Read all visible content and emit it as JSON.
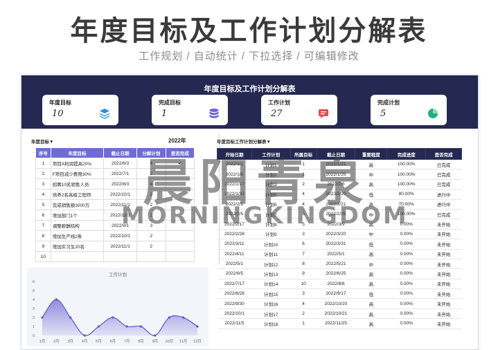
{
  "hero": {
    "title": "年度目标及工作计划分解表",
    "subtitle": "工作规划 / 自动统计 / 下拉选择 / 可编辑修改"
  },
  "sheet": {
    "banner_title": "年度目标及工作计划分解表",
    "kpis": [
      {
        "label": "年度目标",
        "value": "10",
        "icon": "layers-icon",
        "color": "#2f8fe0"
      },
      {
        "label": "完成目标",
        "value": "1",
        "icon": "database-icon",
        "color": "#6c63d8"
      },
      {
        "label": "工作计划",
        "value": "27",
        "icon": "chat-icon",
        "color": "#e04a4a"
      },
      {
        "label": "完成计划",
        "value": "5",
        "icon": "pie-icon",
        "color": "#22b07d"
      }
    ]
  },
  "left": {
    "selector_label": "年度目标▼",
    "year_label": "2022年",
    "headers": [
      "序号",
      "年度目标",
      "截止日期",
      "分解计划",
      "是否完成"
    ],
    "rows": [
      [
        "1",
        "项目A利润提高20%",
        "2022/6/3",
        "4",
        "✔"
      ],
      [
        "2",
        "F项目减少费用30%",
        "2022/7/1",
        "2",
        ""
      ],
      [
        "3",
        "招聘10名销售人员",
        "2022/8/3",
        "4",
        ""
      ],
      [
        "4",
        "培养2名高级工程师",
        "2022/10/1",
        "2",
        ""
      ],
      [
        "5",
        "完成销售额3000万",
        "2022/11/1",
        "2",
        ""
      ],
      [
        "6",
        "增加部门1个",
        "2022/12/1",
        "2",
        ""
      ],
      [
        "7",
        "调整薪酬结构",
        "2022/9/1",
        "3",
        ""
      ],
      [
        "8",
        "增加生产线2条",
        "2022/10/1",
        "2",
        ""
      ],
      [
        "9",
        "增加实习生20名",
        "2022/11/1",
        "2",
        ""
      ],
      [
        "10",
        "",
        "",
        "",
        ""
      ]
    ]
  },
  "watermark": {
    "line1": "晨阳青泉",
    "line2": "MORNINGKINGDOM"
  },
  "chart_data": {
    "type": "area",
    "title": "工作计划",
    "categories": [
      "1月",
      "2月",
      "3月",
      "4月",
      "5月",
      "6月",
      "7月",
      "8月",
      "9月",
      "10月",
      "11月",
      "12月"
    ],
    "values": [
      2,
      4,
      2,
      0,
      1,
      2,
      1,
      1,
      0,
      2,
      2,
      1
    ],
    "ylim": [
      0,
      6
    ],
    "yticks": [
      "0",
      "1",
      "2",
      "3",
      "4",
      "5",
      "6"
    ],
    "color": "#7e7ad8",
    "grid": false
  },
  "right": {
    "selector_label": "年度目标工作计划分解表▼",
    "headers": [
      "开始日期",
      "工作计划",
      "所属目标",
      "截止日期",
      "重要程度",
      "完成进度",
      "是否完成"
    ],
    "rows": [
      [
        "2022/1/1",
        "计划1",
        "1",
        "2022/1/21",
        "高",
        "100.00%",
        "已完成"
      ],
      [
        "2022/1/5",
        "计划2",
        "1",
        "2022/1/25",
        "中",
        "100.00%",
        "已完成"
      ],
      [
        "2022/1/17",
        "计划3",
        "2",
        "2022/2/6",
        "高",
        "100.00%",
        "已完成"
      ],
      [
        "2022/1/31",
        "计划5",
        "4",
        "2022/2/20",
        "低",
        "80.00%",
        "进行中"
      ],
      [
        "2022/2/1",
        "计划6",
        "4",
        "2022/2/21",
        "高",
        "70.00%",
        "进行中"
      ],
      [
        "2022/2/5",
        "计划7",
        "5",
        "2022/2/25",
        "中",
        "100.00%",
        "已完成"
      ],
      [
        "2022/2/17",
        "计划8",
        "5",
        "2022/3/9",
        "高",
        "0.00%",
        "未开始"
      ],
      [
        "2022/2/28",
        "计划9",
        "3",
        "2022/3/20",
        "中",
        "0.00%",
        "未开始"
      ],
      [
        "2022/3/11",
        "计划10",
        "6",
        "2022/3/31",
        "低",
        "0.00%",
        "未开始"
      ],
      [
        "2022/4/11",
        "计划11",
        "7",
        "2022/5/1",
        "高",
        "0.00%",
        "未开始"
      ],
      [
        "2022/5/1",
        "计划12",
        "8",
        "2022/5/21",
        "中",
        "0.00%",
        "未开始"
      ],
      [
        "2022/6/5",
        "计划13",
        "9",
        "2022/6/25",
        "高",
        "0.00%",
        "未开始"
      ],
      [
        "2022/7/17",
        "计划14",
        "10",
        "2022/8/6",
        "高",
        "0.00%",
        "未开始"
      ],
      [
        "2022/8/28",
        "计划15",
        "3",
        "2022/9/17",
        "低",
        "0.00%",
        "未开始"
      ],
      [
        "2022/9/30",
        "计划16",
        "4",
        "2022/10/20",
        "高",
        "0.00%",
        "未开始"
      ],
      [
        "2022/10/1",
        "计划17",
        "2",
        "2022/10/21",
        "高",
        "0.00%",
        "未开始"
      ],
      [
        "2022/11/5",
        "计划18",
        "1",
        "2022/11/25",
        "高",
        "0.00%",
        "未开始"
      ]
    ]
  }
}
